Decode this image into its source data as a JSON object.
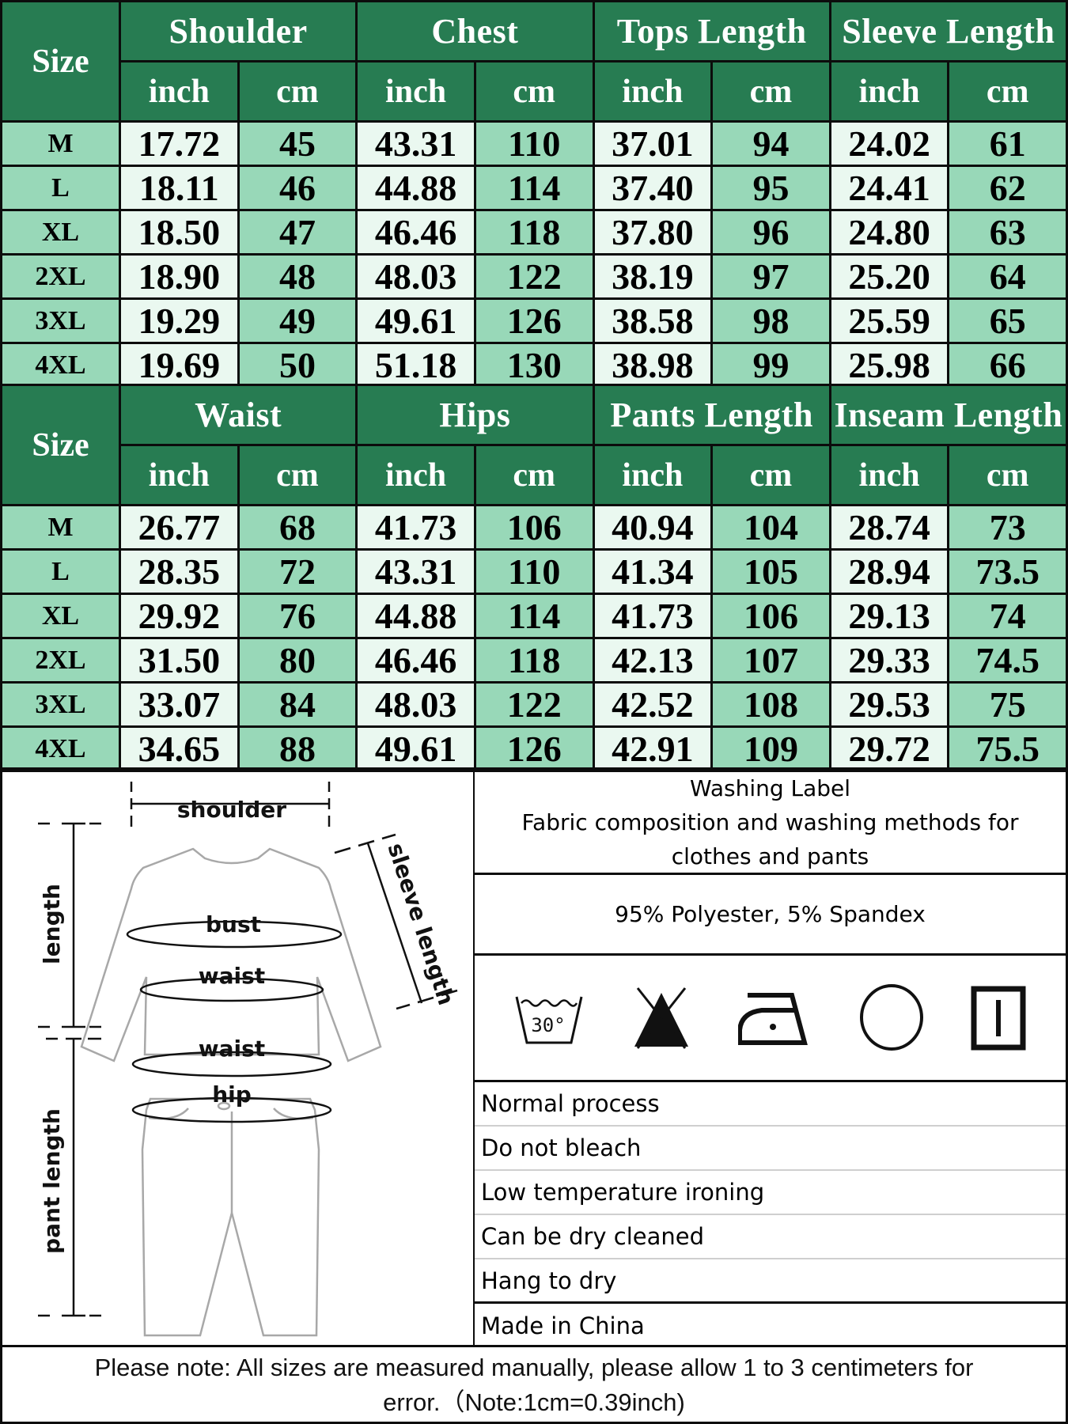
{
  "tops_table": {
    "size_header": "Size",
    "groups": [
      "Shoulder",
      "Chest",
      "Tops Length",
      "Sleeve Length"
    ],
    "units": [
      "inch",
      "cm",
      "inch",
      "cm",
      "inch",
      "cm",
      "inch",
      "cm"
    ],
    "rows": [
      {
        "size": "M",
        "values": [
          "17.72",
          "45",
          "43.31",
          "110",
          "37.01",
          "94",
          "24.02",
          "61"
        ]
      },
      {
        "size": "L",
        "values": [
          "18.11",
          "46",
          "44.88",
          "114",
          "37.40",
          "95",
          "24.41",
          "62"
        ]
      },
      {
        "size": "XL",
        "values": [
          "18.50",
          "47",
          "46.46",
          "118",
          "37.80",
          "96",
          "24.80",
          "63"
        ]
      },
      {
        "size": "2XL",
        "values": [
          "18.90",
          "48",
          "48.03",
          "122",
          "38.19",
          "97",
          "25.20",
          "64"
        ]
      },
      {
        "size": "3XL",
        "values": [
          "19.29",
          "49",
          "49.61",
          "126",
          "38.58",
          "98",
          "25.59",
          "65"
        ]
      },
      {
        "size": "4XL",
        "values": [
          "19.69",
          "50",
          "51.18",
          "130",
          "38.98",
          "99",
          "25.98",
          "66"
        ]
      }
    ]
  },
  "pants_table": {
    "size_header": "Size",
    "groups": [
      "Waist",
      "Hips",
      "Pants Length",
      "Inseam Length"
    ],
    "units": [
      "inch",
      "cm",
      "inch",
      "cm",
      "inch",
      "cm",
      "inch",
      "cm"
    ],
    "rows": [
      {
        "size": "M",
        "values": [
          "26.77",
          "68",
          "41.73",
          "106",
          "40.94",
          "104",
          "28.74",
          "73"
        ]
      },
      {
        "size": "L",
        "values": [
          "28.35",
          "72",
          "43.31",
          "110",
          "41.34",
          "105",
          "28.94",
          "73.5"
        ]
      },
      {
        "size": "XL",
        "values": [
          "29.92",
          "76",
          "44.88",
          "114",
          "41.73",
          "106",
          "29.13",
          "74"
        ]
      },
      {
        "size": "2XL",
        "values": [
          "31.50",
          "80",
          "46.46",
          "118",
          "42.13",
          "107",
          "29.33",
          "74.5"
        ]
      },
      {
        "size": "3XL",
        "values": [
          "33.07",
          "84",
          "48.03",
          "122",
          "42.52",
          "108",
          "29.53",
          "75"
        ]
      },
      {
        "size": "4XL",
        "values": [
          "34.65",
          "88",
          "49.61",
          "126",
          "42.91",
          "109",
          "29.72",
          "75.5"
        ]
      }
    ]
  },
  "diagram": {
    "labels": {
      "shoulder": "shoulder",
      "length": "length",
      "sleeve_length": "sleeve length",
      "bust": "bust",
      "top_waist": "waist",
      "pant_waist": "waist",
      "hip": "hip",
      "pant_length": "pant length"
    }
  },
  "washing_label": {
    "title": "Washing Label",
    "subtitle": "Fabric composition and washing methods for clothes and pants",
    "fabric": "95% Polyester, 5% Spandex",
    "icons": [
      {
        "name": "wash-30-icon",
        "text": "30°"
      },
      {
        "name": "do-not-bleach-icon"
      },
      {
        "name": "low-iron-icon"
      },
      {
        "name": "dry-clean-icon"
      },
      {
        "name": "hang-dry-icon"
      }
    ],
    "care_instructions": [
      "Normal process",
      "Do not bleach",
      "Low temperature ironing",
      "Can be dry cleaned",
      "Hang to dry"
    ],
    "origin": "Made in China"
  },
  "footer_note": {
    "line1": "Please note: All sizes are measured manually, please allow 1 to 3 centimeters for",
    "line2": "error.（Note:1cm=0.39inch)"
  },
  "colors": {
    "header_green": "#277c52",
    "mid_green": "#98d8b8",
    "light_green": "#eaf8f0"
  }
}
